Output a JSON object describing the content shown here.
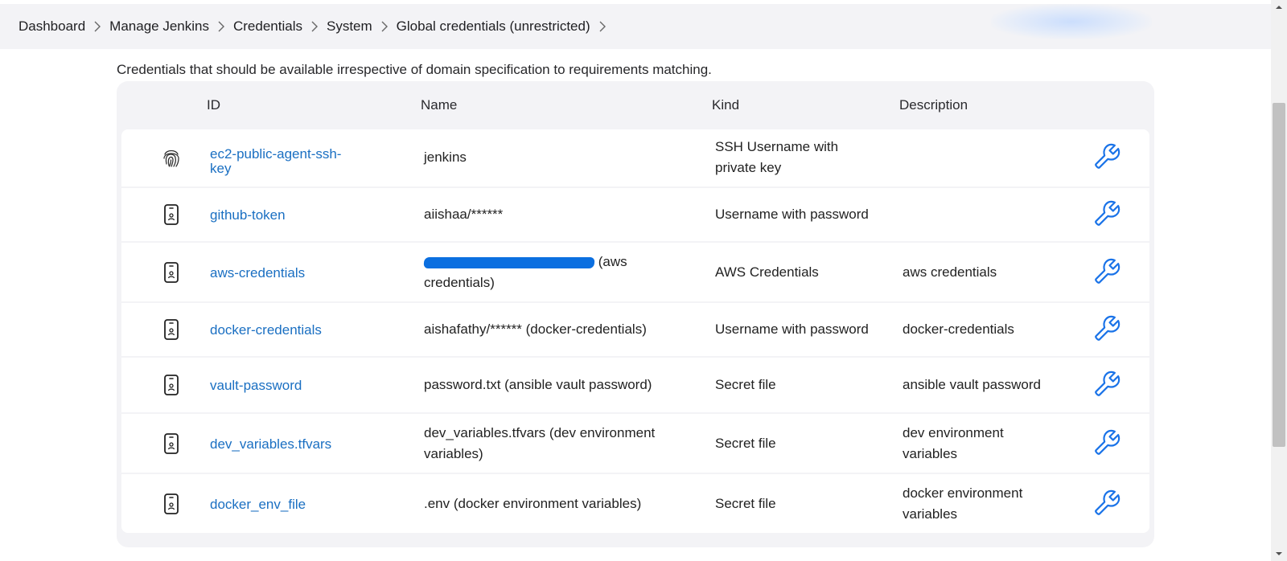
{
  "breadcrumb": [
    "Dashboard",
    "Manage Jenkins",
    "Credentials",
    "System",
    "Global credentials (unrestricted)"
  ],
  "description": "Credentials that should be available irrespective of domain specification to requirements matching.",
  "table": {
    "headers": {
      "id": "ID",
      "name": "Name",
      "kind": "Kind",
      "description": "Description"
    },
    "rows": [
      {
        "icon": "fingerprint-icon",
        "id": "ec2-public-agent-ssh-key",
        "name": "jenkins",
        "kind": "SSH Username with private key",
        "description": ""
      },
      {
        "icon": "mobile-badge-icon",
        "id": "github-token",
        "name": "aiishaa/******",
        "kind": "Username with password",
        "description": ""
      },
      {
        "icon": "mobile-badge-icon",
        "id": "aws-credentials",
        "name_suffix": " (aws credentials)",
        "kind": "AWS Credentials",
        "description": "aws credentials"
      },
      {
        "icon": "mobile-badge-icon",
        "id": "docker-credentials",
        "name": "aishafathy/****** (docker-credentials)",
        "kind": "Username with password",
        "description": "docker-credentials"
      },
      {
        "icon": "mobile-badge-icon",
        "id": "vault-password",
        "name": "password.txt (ansible vault password)",
        "kind": "Secret file",
        "description": "ansible vault password"
      },
      {
        "icon": "mobile-badge-icon",
        "id": "dev_variables.tfvars",
        "name": "dev_variables.tfvars (dev environment variables)",
        "kind": "Secret file",
        "description": "dev environment variables"
      },
      {
        "icon": "mobile-badge-icon",
        "id": "docker_env_file",
        "name": ".env (docker environment variables)",
        "kind": "Secret file",
        "description": "docker environment variables"
      }
    ]
  },
  "colors": {
    "link": "#1a6fc2",
    "header_bg": "#f3f3f6",
    "redaction": "#0b6fe0"
  },
  "action_icon": "wrench-icon"
}
